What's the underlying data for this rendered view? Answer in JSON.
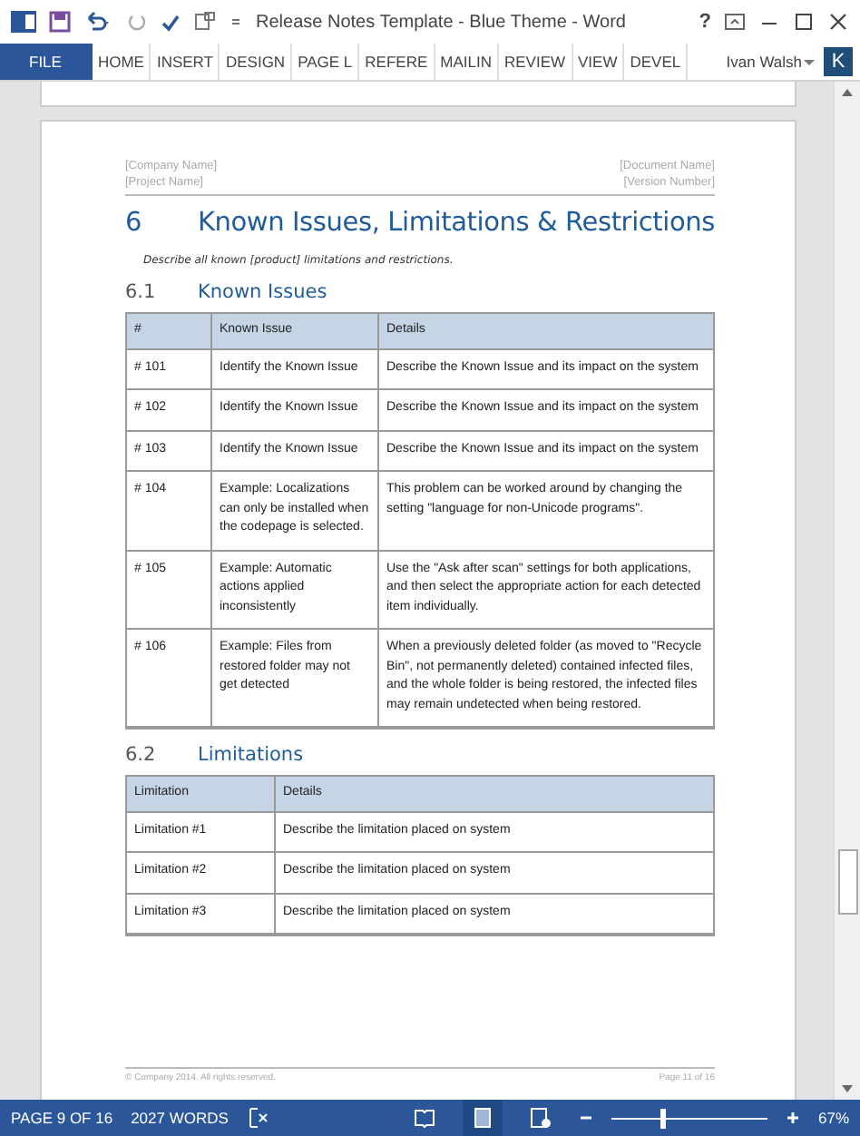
{
  "window": {
    "title": "Release Notes Template - Blue Theme - Word",
    "help": "?"
  },
  "ribbon": {
    "tabs": [
      {
        "label": "FILE",
        "selected": true
      },
      {
        "label": "HOME",
        "selected": false
      },
      {
        "label": "INSERT",
        "selected": false
      },
      {
        "label": "DESIGN",
        "selected": false
      },
      {
        "label": "PAGE L",
        "selected": false
      },
      {
        "label": "REFERE",
        "selected": false
      },
      {
        "label": "MAILIN",
        "selected": false
      },
      {
        "label": "REVIEW",
        "selected": false
      },
      {
        "label": "VIEW",
        "selected": false
      },
      {
        "label": "DEVEL",
        "selected": false
      }
    ],
    "user": "Ivan Walsh",
    "avatar": "K"
  },
  "page": {
    "header": {
      "left": [
        "[Company Name]",
        "[Project Name]"
      ],
      "right": [
        "[Document Name]",
        "[Version Number]"
      ]
    },
    "heading": {
      "number": "6",
      "text": "Known Issues, Limitations & Restrictions"
    },
    "intro": "Describe all known [product] limitations and restrictions.",
    "sections": [
      {
        "number": "6.1",
        "title": "Known Issues",
        "columns": [
          "#",
          "Known Issue",
          "Details"
        ],
        "rows": [
          [
            "# 101",
            "Identify the Known Issue",
            "Describe the Known Issue and its impact on the system"
          ],
          [
            "# 102",
            "Identify the Known Issue",
            "Describe the Known Issue and its impact on the system"
          ],
          [
            "# 103",
            "Identify the Known Issue",
            "Describe the Known Issue and its impact on the system"
          ],
          [
            "# 104",
            "Example: Localizations can only be installed when the codepage is selected.",
            "This problem can be worked around by changing the setting \"language for non-Unicode programs\"."
          ],
          [
            "# 105",
            "Example: Automatic actions applied inconsistently",
            "Use the \"Ask after scan\" settings for both applications, and then select the appropriate action for each detected item individually."
          ],
          [
            "# 106",
            "Example: Files from restored folder may not get detected",
            "When a previously deleted folder (as moved to \"Recycle Bin\", not permanently deleted) contained infected files, and the whole folder is being restored, the infected files may remain undetected when being restored."
          ]
        ]
      },
      {
        "number": "6.2",
        "title": "Limitations",
        "columns": [
          "Limitation",
          "Details"
        ],
        "rows": [
          [
            "Limitation #1",
            "Describe the limitation placed on system"
          ],
          [
            "Limitation #2",
            "Describe the limitation placed on system"
          ],
          [
            "Limitation #3",
            "Describe the limitation placed on system"
          ]
        ]
      }
    ],
    "footer": {
      "left": "© Company 2014. All rights reserved.",
      "right": "Page 11 of 16"
    }
  },
  "status_bar": {
    "page": "PAGE 9 OF 16",
    "words": "2027 WORDS",
    "views": [
      {
        "kind": "read",
        "selected": false
      },
      {
        "kind": "print",
        "selected": true
      },
      {
        "kind": "web",
        "selected": false
      }
    ],
    "zoom": {
      "level": 0.33,
      "reading": "67%"
    }
  }
}
